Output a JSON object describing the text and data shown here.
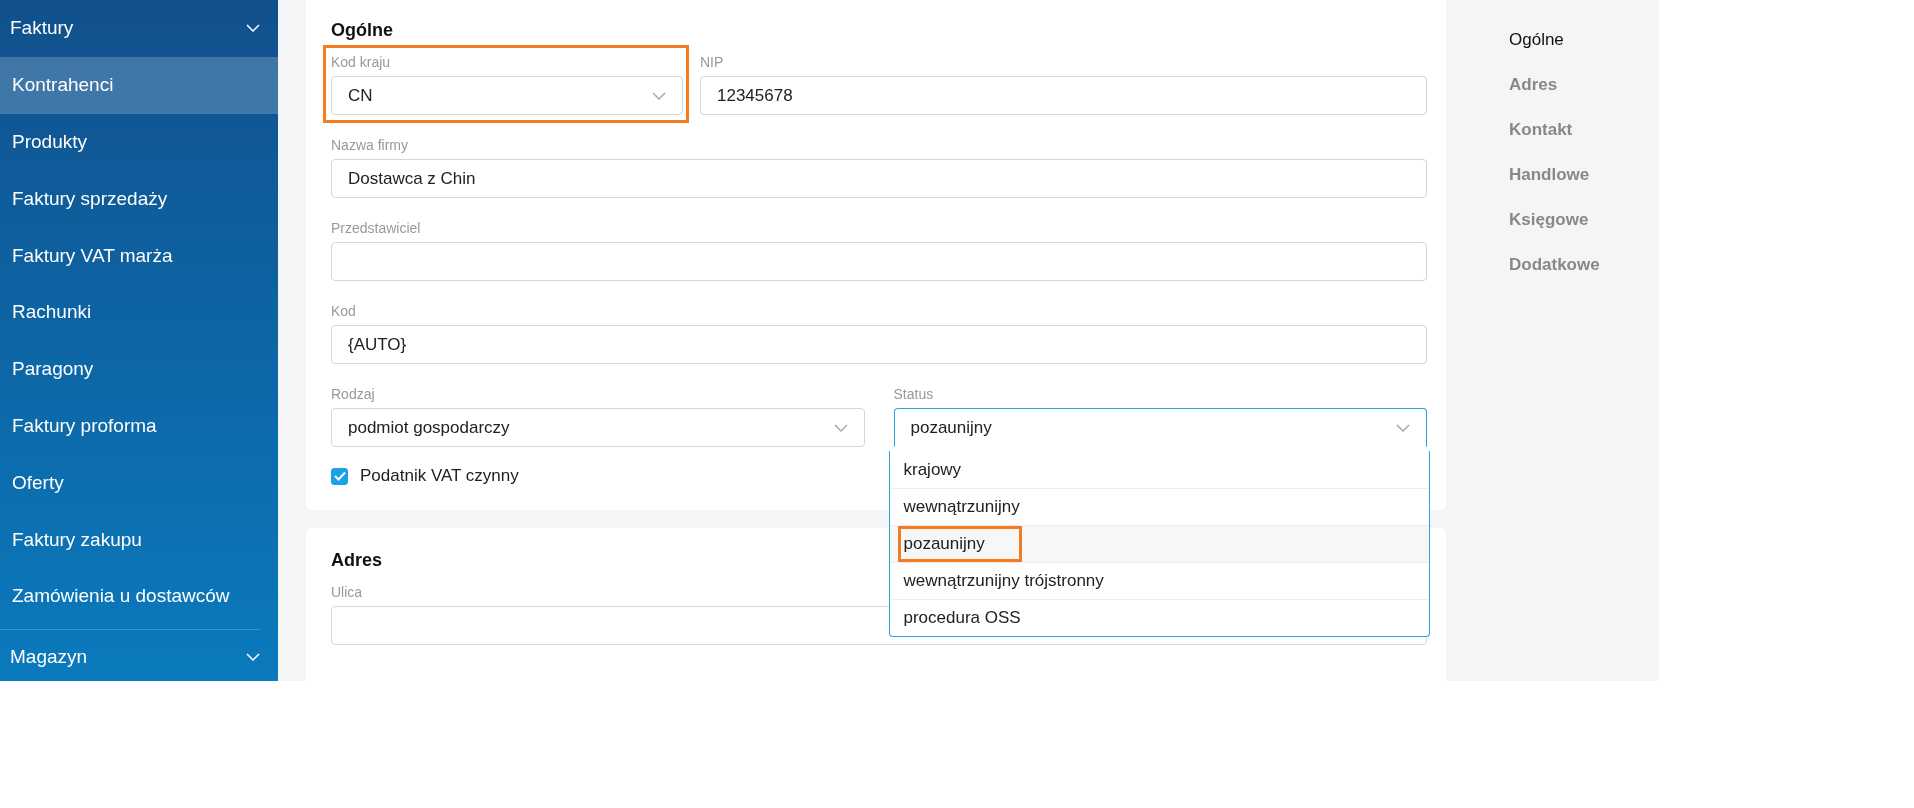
{
  "sidebar": {
    "items": [
      {
        "label": "Faktury",
        "kind": "group",
        "selected": false
      },
      {
        "label": "Kontrahenci",
        "kind": "item",
        "selected": true
      },
      {
        "label": "Produkty",
        "kind": "item",
        "selected": false
      },
      {
        "label": "Faktury sprzedaży",
        "kind": "item",
        "selected": false
      },
      {
        "label": "Faktury VAT marża",
        "kind": "item",
        "selected": false
      },
      {
        "label": "Rachunki",
        "kind": "item",
        "selected": false
      },
      {
        "label": "Paragony",
        "kind": "item",
        "selected": false
      },
      {
        "label": "Faktury proforma",
        "kind": "item",
        "selected": false
      },
      {
        "label": "Oferty",
        "kind": "item",
        "selected": false
      },
      {
        "label": "Faktury zakupu",
        "kind": "item",
        "selected": false
      },
      {
        "label": "Zamówienia u dostawców",
        "kind": "item",
        "selected": false
      },
      {
        "label": "Magazyn",
        "kind": "group",
        "selected": false
      }
    ]
  },
  "sections": [
    {
      "title": "Ogólne",
      "rows": [
        {
          "fields": [
            {
              "label": "Kod kraju",
              "kind": "select",
              "value": "CN",
              "highlighted": true
            },
            {
              "label": "NIP",
              "kind": "text",
              "value": "12345678",
              "highlighted": false
            }
          ]
        },
        {
          "fields": [
            {
              "label": "Nazwa firmy",
              "kind": "text",
              "value": "Dostawca z Chin",
              "highlighted": false
            }
          ]
        },
        {
          "fields": [
            {
              "label": "Przedstawiciel",
              "kind": "text",
              "highlighted": false
            }
          ]
        },
        {
          "fields": [
            {
              "label": "Kod",
              "kind": "text",
              "value": "{AUTO}",
              "highlighted": false
            }
          ]
        },
        {
          "fields": [
            {
              "label": "Rodzaj",
              "kind": "select",
              "value": "podmiot gospodarczy",
              "highlighted": false
            },
            {
              "label": "Status",
              "kind": "select",
              "value": "pozaunijny",
              "highlighted": false,
              "open": true,
              "options": [
                {
                  "label": "krajowy",
                  "selected": false,
                  "highlighted": false
                },
                {
                  "label": "wewnątrzunijny",
                  "selected": false,
                  "highlighted": false
                },
                {
                  "label": "pozaunijny",
                  "selected": true,
                  "highlighted": true
                },
                {
                  "label": "wewnątrzunijny trójstronny",
                  "selected": false,
                  "highlighted": false
                },
                {
                  "label": "procedura OSS",
                  "selected": false,
                  "highlighted": false
                }
              ]
            }
          ]
        }
      ],
      "checkbox": {
        "label": "Podatnik VAT czynny",
        "checked": true
      }
    },
    {
      "title": "Adres",
      "rows": [
        {
          "fields": [
            {
              "label": "Ulica",
              "kind": "text",
              "highlighted": false
            }
          ]
        }
      ]
    }
  ],
  "section_nav": [
    {
      "label": "Ogólne",
      "selected": true
    },
    {
      "label": "Adres",
      "selected": false
    },
    {
      "label": "Kontakt",
      "selected": false
    },
    {
      "label": "Handlowe",
      "selected": false
    },
    {
      "label": "Księgowe",
      "selected": false
    },
    {
      "label": "Dodatkowe",
      "selected": false
    }
  ]
}
